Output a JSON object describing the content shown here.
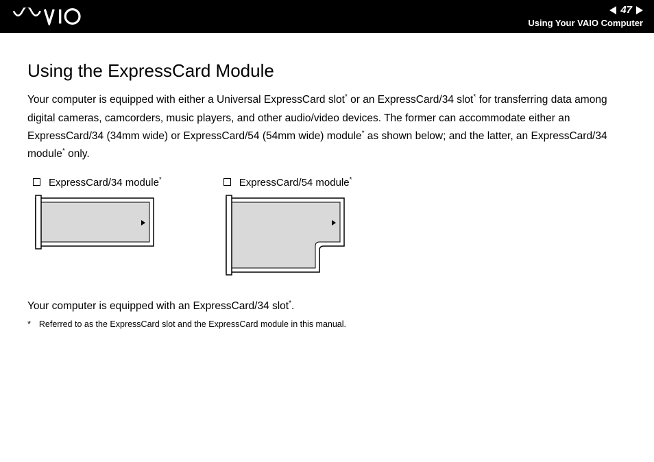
{
  "header": {
    "page_number": "47",
    "subtitle": "Using Your VAIO Computer"
  },
  "content": {
    "title": "Using the ExpressCard Module",
    "intro_part1": "Your computer is equipped with either a Universal ExpressCard slot",
    "intro_part2": " or an ExpressCard/34 slot",
    "intro_part3": " for transferring data among digital cameras, camcorders, music players, and other audio/video devices. The former can accommodate either an ExpressCard/34 (34mm wide) or ExpressCard/54 (54mm wide) module",
    "intro_part4": " as shown below; and the latter, an ExpressCard/34 module",
    "intro_part5": " only.",
    "module34_label": "ExpressCard/34 module",
    "module54_label": "ExpressCard/54 module",
    "equipped_text_part1": "Your computer is equipped with an ExpressCard/34 slot",
    "equipped_text_part2": ".",
    "footnote_marker": "*",
    "footnote_text": "Referred to as the ExpressCard slot and the ExpressCard module in this manual."
  }
}
